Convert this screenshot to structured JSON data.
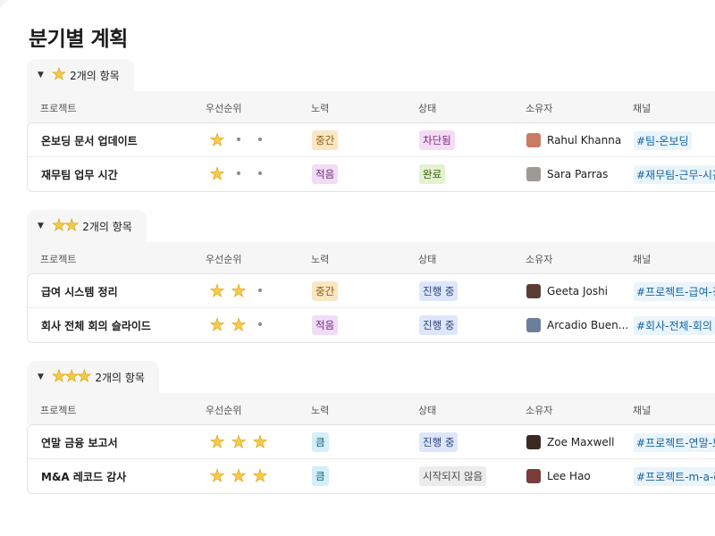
{
  "title": "분기별 계획",
  "columns": [
    "프로젝트",
    "우선순위",
    "노력",
    "상태",
    "소유자",
    "채널"
  ],
  "groups": [
    {
      "stars": 1,
      "label": "2개의 항목",
      "rows": [
        {
          "project": "온보딩 문서 업데이트",
          "priority": 1,
          "effort": "중간",
          "effort_color": "#fbe6c4",
          "effort_text": "#8a5a00",
          "status": "차단됨",
          "status_color": "#f4dcf5",
          "status_text": "#7a2b7e",
          "owner": "Rahul Khanna",
          "avatar": "#c97b63",
          "channel": "#팀-온보딩"
        },
        {
          "project": "재무팀 업무 시간",
          "priority": 1,
          "effort": "적음",
          "effort_color": "#f1dcf7",
          "effort_text": "#6c2a7a",
          "status": "완료",
          "status_color": "#e3f2cf",
          "status_text": "#3a5a13",
          "owner": "Sara Parras",
          "avatar": "#9e9a93",
          "channel": "#재무팀-근무-시간"
        }
      ]
    },
    {
      "stars": 2,
      "label": "2개의 항목",
      "rows": [
        {
          "project": "급여 시스템 정리",
          "priority": 2,
          "effort": "중간",
          "effort_color": "#fbe6c4",
          "effort_text": "#8a5a00",
          "status": "진행 중",
          "status_color": "#dde6fb",
          "status_text": "#2a3f7a",
          "owner": "Geeta Joshi",
          "avatar": "#5a3e36",
          "channel": "#프로젝트-급여-정리"
        },
        {
          "project": "회사 전체 회의 슬라이드",
          "priority": 2,
          "effort": "적음",
          "effort_color": "#f1dcf7",
          "effort_text": "#6c2a7a",
          "status": "진행 중",
          "status_color": "#dde6fb",
          "status_text": "#2a3f7a",
          "owner": "Arcadio Buen...",
          "avatar": "#6b7f9a",
          "channel": "#회사-전체-회의"
        }
      ]
    },
    {
      "stars": 3,
      "label": "2개의 항목",
      "rows": [
        {
          "project": "연말 금융 보고서",
          "priority": 3,
          "effort": "큼",
          "effort_color": "#d3eff8",
          "effort_text": "#1a5f78",
          "status": "진행 중",
          "status_color": "#dde6fb",
          "status_text": "#2a3f7a",
          "owner": "Zoe Maxwell",
          "avatar": "#3b2a22",
          "channel": "#프로젝트-연말-보고서"
        },
        {
          "project": "M&A 레코드 감사",
          "priority": 3,
          "effort": "큼",
          "effort_color": "#d3eff8",
          "effort_text": "#1a5f78",
          "status": "시작되지 않음",
          "status_color": "#ececec",
          "status_text": "#4a4a4a",
          "owner": "Lee Hao",
          "avatar": "#7a3b3b",
          "channel": "#프로젝트-m-a-레코드"
        }
      ]
    }
  ]
}
